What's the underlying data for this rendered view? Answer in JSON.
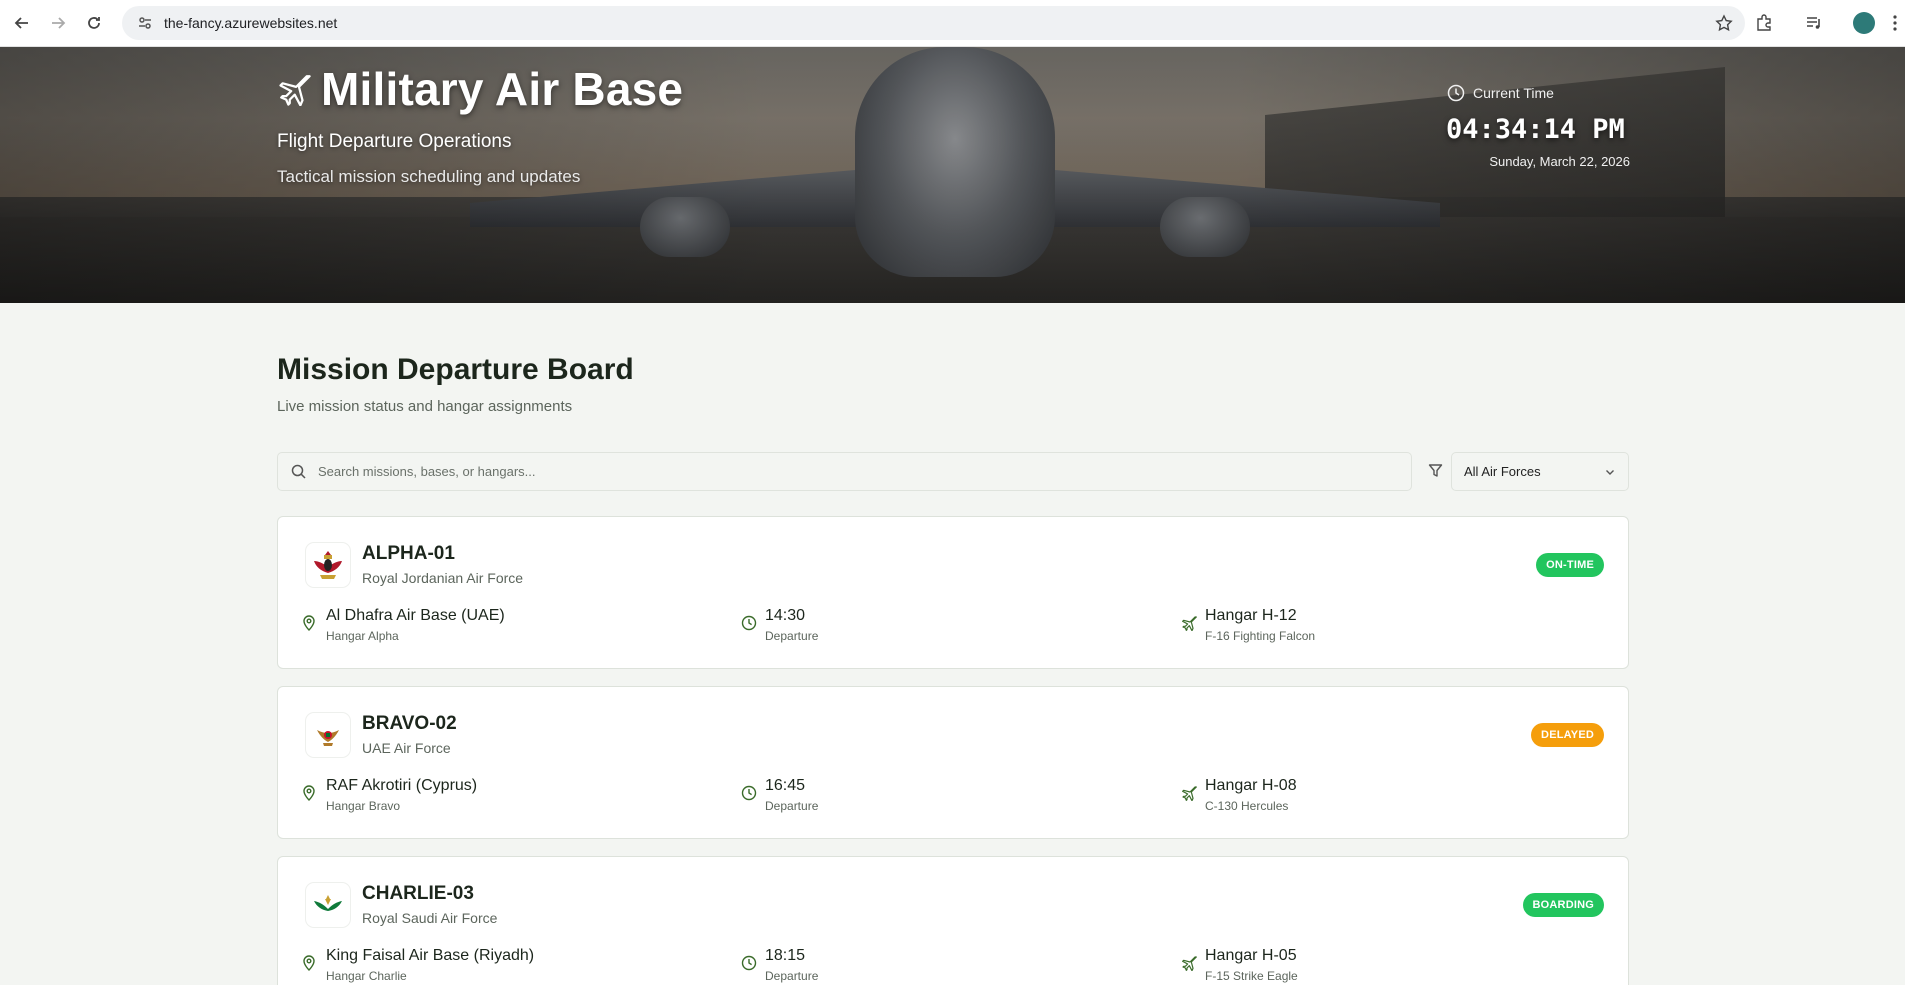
{
  "browser": {
    "url": "the-fancy.azurewebsites.net"
  },
  "hero": {
    "title": "Military Air Base",
    "subtitle": "Flight Departure Operations",
    "tagline": "Tactical mission scheduling and updates",
    "clock_label": "Current Time",
    "clock_time": "04:34:14 PM",
    "clock_date": "Sunday, March 22, 2026"
  },
  "board": {
    "title": "Mission Departure Board",
    "subtitle": "Live mission status and hangar assignments",
    "search_placeholder": "Search missions, bases, or hangars...",
    "filter_selected": "All Air Forces"
  },
  "missions": [
    {
      "callsign": "ALPHA-01",
      "force": "Royal Jordanian Air Force",
      "status": "ON-TIME",
      "status_color": "#22c55e",
      "base": "Al Dhafra Air Base (UAE)",
      "base_sub": "Hangar Alpha",
      "time": "14:30",
      "time_sub": "Departure",
      "hangar": "Hangar H-12",
      "aircraft": "F-16 Fighting Falcon"
    },
    {
      "callsign": "BRAVO-02",
      "force": "UAE Air Force",
      "status": "DELAYED",
      "status_color": "#f59e0b",
      "base": "RAF Akrotiri (Cyprus)",
      "base_sub": "Hangar Bravo",
      "time": "16:45",
      "time_sub": "Departure",
      "hangar": "Hangar H-08",
      "aircraft": "C-130 Hercules"
    },
    {
      "callsign": "CHARLIE-03",
      "force": "Royal Saudi Air Force",
      "status": "BOARDING",
      "status_color": "#22c55e",
      "base": "King Faisal Air Base (Riyadh)",
      "base_sub": "Hangar Charlie",
      "time": "18:15",
      "time_sub": "Departure",
      "hangar": "Hangar H-05",
      "aircraft": "F-15 Strike Eagle"
    }
  ],
  "colors": {
    "accent": "#3a6b2a",
    "background": "#f3f5f2"
  }
}
